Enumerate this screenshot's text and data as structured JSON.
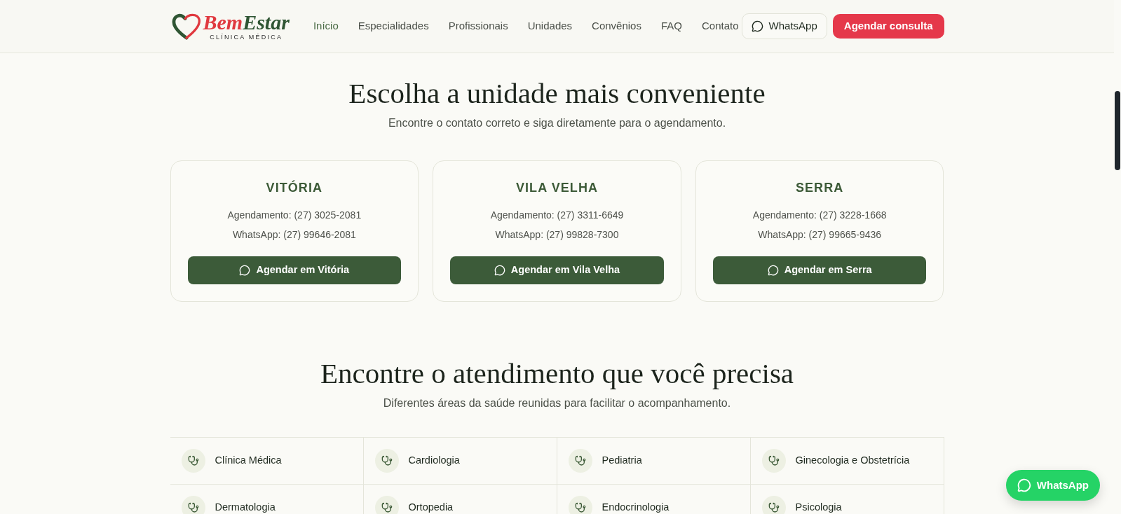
{
  "header": {
    "logo": {
      "wordmark": [
        "Bem",
        "Estar"
      ],
      "tagline": "CLÍNICA MÉDICA"
    },
    "nav": [
      {
        "label": "Início",
        "selected": true
      },
      {
        "label": "Especialidades",
        "selected": false
      },
      {
        "label": "Profissionais",
        "selected": false
      },
      {
        "label": "Unidades",
        "selected": false
      },
      {
        "label": "Convênios",
        "selected": false
      },
      {
        "label": "FAQ",
        "selected": false
      },
      {
        "label": "Contato",
        "selected": false
      }
    ],
    "whatsapp_button": "WhatsApp",
    "cta_button": "Agendar consulta"
  },
  "units_section": {
    "title": "Escolha a unidade mais conveniente",
    "subtitle": "Encontre o contato correto e siga diretamente para o agendamento.",
    "units": [
      {
        "name": "VITÓRIA",
        "scheduling": "Agendamento: (27) 3025-2081",
        "whatsapp": "WhatsApp: (27) 99646-2081",
        "button": "Agendar em Vitória"
      },
      {
        "name": "VILA VELHA",
        "scheduling": "Agendamento: (27) 3311-6649",
        "whatsapp": "WhatsApp: (27) 99828-7300",
        "button": "Agendar em Vila Velha"
      },
      {
        "name": "SERRA",
        "scheduling": "Agendamento: (27) 3228-1668",
        "whatsapp": "WhatsApp: (27) 99665-9436",
        "button": "Agendar em Serra"
      }
    ]
  },
  "specialties_section": {
    "title": "Encontre o atendimento que você precisa",
    "subtitle": "Diferentes áreas da saúde reunidas para facilitar o acompanhamento.",
    "items": [
      "Clínica Médica",
      "Cardiologia",
      "Pediatria",
      "Ginecologia e Obstetrícia",
      "Dermatologia",
      "Ortopedia",
      "Endocrinologia",
      "Psicologia"
    ]
  },
  "floating_whatsapp": "WhatsApp"
}
